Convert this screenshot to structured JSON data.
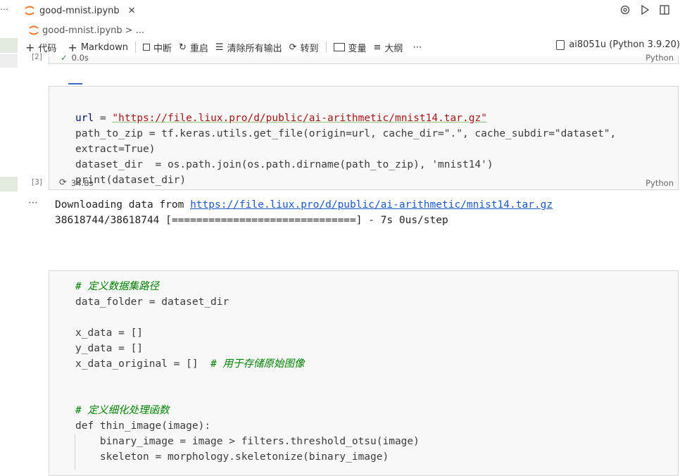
{
  "tab": {
    "title": "good-mnist.ipynb",
    "close": "✕",
    "more": "⋯"
  },
  "breadcrumb": {
    "file": "good-mnist.ipynb",
    "sep": ">",
    "tail": "..."
  },
  "toolbar": {
    "add_code": "代码",
    "add_markdown": "Markdown",
    "interrupt": "中断",
    "restart": "重启",
    "clear_outputs": "清除所有输出",
    "goto": "转到",
    "variables": "变量",
    "outline": "大纲",
    "more": "⋯",
    "kernel": "ai8051u (Python 3.9.20)"
  },
  "cells": {
    "prev": {
      "exec": "[2]",
      "status": "0.0s",
      "lang": "Python"
    },
    "cell3": {
      "exec": "[3]",
      "status": "34.8s",
      "lang": "Python",
      "lines": {
        "l1a": "url",
        "l1b": " = ",
        "l1c": "\"https://file.liux.pro/d/public/ai-arithmetic/mnist14.tar.gz\"",
        "l2": "path_to_zip = tf.keras.utils.get_file(origin=url, cache_dir=\".\", cache_subdir=\"dataset\",",
        "l3": "extract=True)",
        "l4": "dataset_dir  = os.path.join(os.path.dirname(path_to_zip), 'mnist14')",
        "l5": "print(dataset_dir)"
      }
    },
    "output": {
      "dots": "⋯",
      "line1_prefix": "Downloading data from ",
      "line1_link": "https://file.liux.pro/d/public/ai-arithmetic/mnist14.tar.gz",
      "line2": "38618744/38618744 [==============================] - 7s 0us/step"
    },
    "cell4": {
      "c1": "# 定义数据集路径",
      "c2": "data_folder = dataset_dir",
      "c3": "x_data = []",
      "c4": "y_data = []",
      "c5a": "x_data_original = []",
      "c5b": "  # 用于存储原始图像",
      "c6": "# 定义细化处理函数",
      "c7": "def thin_image(image):",
      "c8": "    binary_image = image > filters.threshold_otsu(image)",
      "c9": "    skeleton = morphology.skeletonize(binary_image)"
    }
  }
}
